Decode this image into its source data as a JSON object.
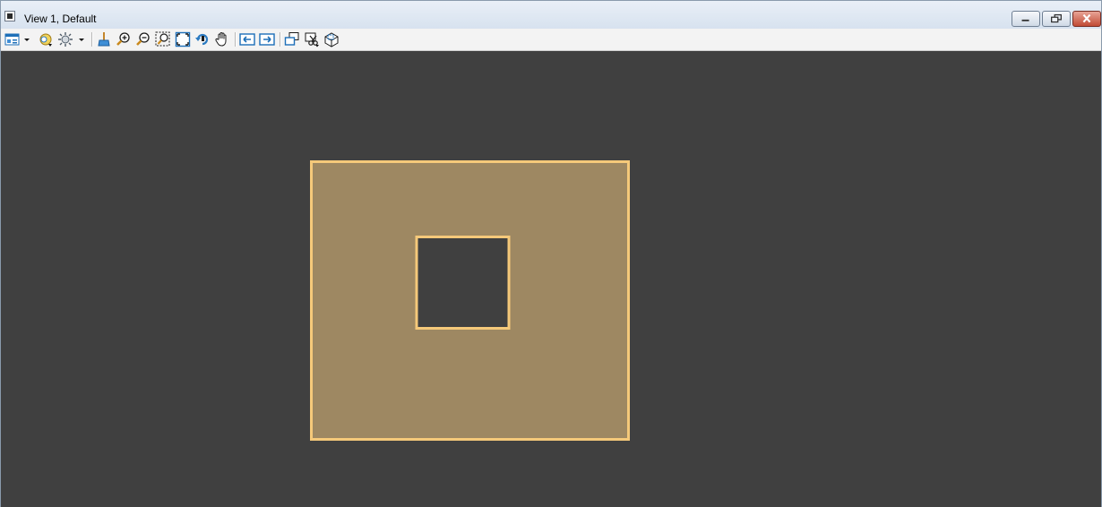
{
  "window": {
    "title": "View 1, Default"
  },
  "title_buttons": {
    "minimize": "minimize-icon",
    "restore": "restore-icon",
    "close": "close-icon"
  },
  "toolbar": {
    "items": [
      "view-attributes-icon",
      "dropdown-arrow-icon",
      "levels-display-icon",
      "view-display-style-icon",
      "dropdown-arrow-icon",
      "update-view-icon",
      "zoom-in-icon",
      "zoom-out-icon",
      "window-area-icon",
      "fit-view-icon",
      "rotate-view-icon",
      "pan-view-icon",
      "view-previous-icon",
      "view-next-icon",
      "copy-view-icon",
      "clip-volume-icon",
      "clip-mask-icon"
    ]
  },
  "colors": {
    "canvas_background": "#404040",
    "shape_fill": "#9e8862",
    "shape_outline": "#f5c97a",
    "hole_fill": "#404040"
  }
}
